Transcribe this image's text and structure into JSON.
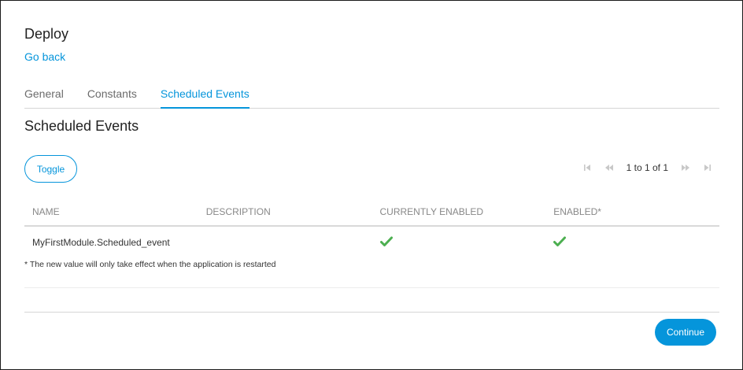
{
  "page": {
    "title": "Deploy",
    "go_back": "Go back"
  },
  "tabs": [
    {
      "label": "General",
      "active": false
    },
    {
      "label": "Constants",
      "active": false
    },
    {
      "label": "Scheduled Events",
      "active": true
    }
  ],
  "section_title": "Scheduled Events",
  "toolbar": {
    "toggle_label": "Toggle"
  },
  "pager": {
    "text": "1 to 1 of 1",
    "icons": [
      "first-page-icon",
      "previous-page-icon",
      "next-page-icon",
      "last-page-icon"
    ]
  },
  "grid": {
    "columns": [
      "NAME",
      "DESCRIPTION",
      "CURRENTLY ENABLED",
      "ENABLED*"
    ],
    "rows": [
      {
        "name": "MyFirstModule.Scheduled_event",
        "description": "",
        "currently_enabled": true,
        "enabled": true
      }
    ]
  },
  "note": "* The new value will only take effect when the application is restarted",
  "footer": {
    "continue_label": "Continue"
  },
  "colors": {
    "accent": "#0595db",
    "check_green": "#4caf50",
    "pager_icon": "#c8c8c8"
  }
}
